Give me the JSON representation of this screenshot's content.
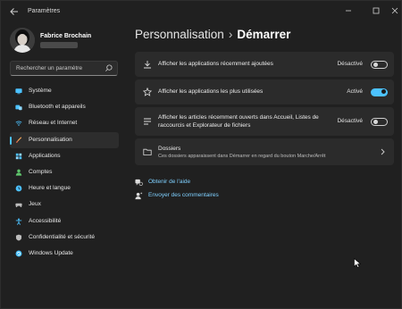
{
  "app": {
    "title": "Paramètres"
  },
  "profile": {
    "name": "Fabrice Brochain"
  },
  "search": {
    "placeholder": "Rechercher un paramètre"
  },
  "sidebar": {
    "items": [
      {
        "label": "Système",
        "icon": "display-icon",
        "color": "#4cc2ff"
      },
      {
        "label": "Bluetooth et appareils",
        "icon": "bluetooth-icon",
        "color": "#4cc2ff"
      },
      {
        "label": "Réseau et Internet",
        "icon": "wifi-icon",
        "color": "#4cc2ff"
      },
      {
        "label": "Personnalisation",
        "icon": "brush-icon",
        "color": "#f2a65a",
        "active": true
      },
      {
        "label": "Applications",
        "icon": "apps-icon",
        "color": "#4cc2ff"
      },
      {
        "label": "Comptes",
        "icon": "person-icon",
        "color": "#5ec46b"
      },
      {
        "label": "Heure et langue",
        "icon": "globe-clock-icon",
        "color": "#4cc2ff"
      },
      {
        "label": "Jeux",
        "icon": "controller-icon",
        "color": "#bdbdbd"
      },
      {
        "label": "Accessibilité",
        "icon": "accessibility-icon",
        "color": "#4cc2ff"
      },
      {
        "label": "Confidentialité et sécurité",
        "icon": "shield-icon",
        "color": "#bdbdbd"
      },
      {
        "label": "Windows Update",
        "icon": "update-icon",
        "color": "#4cc2ff"
      }
    ]
  },
  "header": {
    "section": "Personnalisation",
    "page": "Démarrer"
  },
  "settings": [
    {
      "label": "Afficher les applications récemment ajoutées",
      "state": "Désactivé",
      "on": false,
      "icon": "download-icon"
    },
    {
      "label": "Afficher les applications les plus utilisées",
      "state": "Activé",
      "on": true,
      "icon": "star-icon"
    },
    {
      "label_line1": "Afficher les articles récemment ouverts dans Accueil, Listes de",
      "label_line2": "raccourcis et Explorateur de fichiers",
      "state": "Désactivé",
      "on": false,
      "icon": "list-icon"
    },
    {
      "label": "Dossiers",
      "sublabel": "Ces dossiers apparaissent dans Démarrer en regard du bouton Marche/Arrêt",
      "icon": "folder-icon"
    }
  ],
  "links": {
    "help": "Obtenir de l'aide",
    "feedback": "Envoyer des commentaires"
  },
  "colors": {
    "accent": "#4cc2ff",
    "background": "#202020",
    "card": "#2b2b2b"
  }
}
